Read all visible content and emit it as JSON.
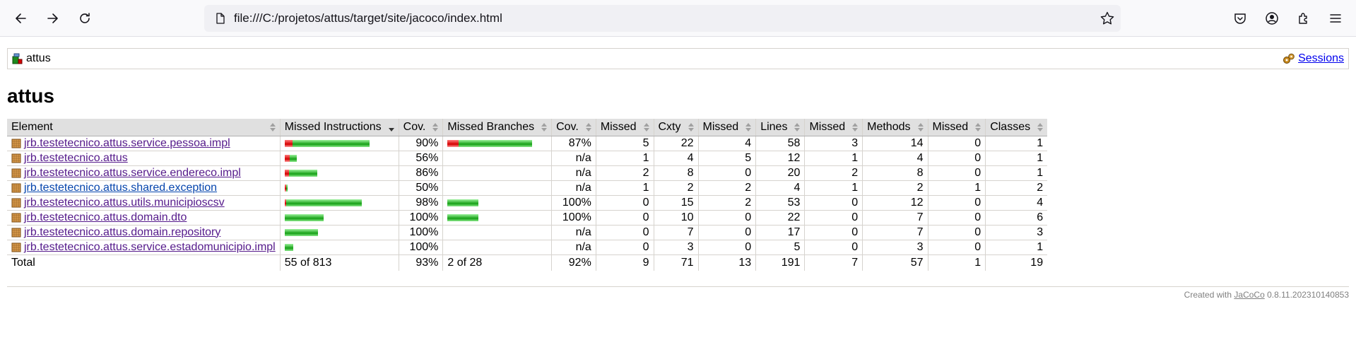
{
  "browser": {
    "url": "file:///C:/projetos/attus/target/site/jacoco/index.html"
  },
  "breadcrumb": {
    "report_name": "attus",
    "sessions_label": "Sessions"
  },
  "page_title": "attus",
  "table": {
    "headers": [
      "Element",
      "Missed Instructions",
      "Cov.",
      "Missed Branches",
      "Cov.",
      "Missed",
      "Cxty",
      "Missed",
      "Lines",
      "Missed",
      "Methods",
      "Missed",
      "Classes"
    ],
    "rows": [
      {
        "name": "jrb.testetecnico.attus.service.pessoa.impl",
        "instr_missed_frac": 0.09,
        "instr_bar": 1.0,
        "instr_cov": "90%",
        "branch_bar": 1.0,
        "branch_missed_frac": 0.13,
        "branch_cov": "87%",
        "cxty_missed": "5",
        "cxty": "22",
        "lines_missed": "4",
        "lines": "58",
        "methods_missed": "3",
        "methods": "14",
        "classes_missed": "0",
        "classes": "1",
        "visited": true
      },
      {
        "name": "jrb.testetecnico.attus",
        "instr_missed_frac": 0.44,
        "instr_bar": 0.14,
        "instr_cov": "56%",
        "branch_bar": 0,
        "branch_missed_frac": 0,
        "branch_cov": "n/a",
        "cxty_missed": "1",
        "cxty": "4",
        "lines_missed": "5",
        "lines": "12",
        "methods_missed": "1",
        "methods": "4",
        "classes_missed": "0",
        "classes": "1",
        "visited": true
      },
      {
        "name": "jrb.testetecnico.attus.service.endereco.impl",
        "instr_missed_frac": 0.14,
        "instr_bar": 0.38,
        "instr_cov": "86%",
        "branch_bar": 0,
        "branch_missed_frac": 0,
        "branch_cov": "n/a",
        "cxty_missed": "2",
        "cxty": "8",
        "lines_missed": "0",
        "lines": "20",
        "methods_missed": "2",
        "methods": "8",
        "classes_missed": "0",
        "classes": "1",
        "visited": true
      },
      {
        "name": "jrb.testetecnico.attus.shared.exception",
        "instr_missed_frac": 0.5,
        "instr_bar": 0.03,
        "instr_cov": "50%",
        "branch_bar": 0,
        "branch_missed_frac": 0,
        "branch_cov": "n/a",
        "cxty_missed": "1",
        "cxty": "2",
        "lines_missed": "2",
        "lines": "4",
        "methods_missed": "1",
        "methods": "2",
        "classes_missed": "1",
        "classes": "2",
        "visited": false
      },
      {
        "name": "jrb.testetecnico.attus.utils.municipioscsv",
        "instr_missed_frac": 0.02,
        "instr_bar": 0.91,
        "instr_cov": "98%",
        "branch_bar": 0.37,
        "branch_missed_frac": 0,
        "branch_cov": "100%",
        "cxty_missed": "0",
        "cxty": "15",
        "lines_missed": "2",
        "lines": "53",
        "methods_missed": "0",
        "methods": "12",
        "classes_missed": "0",
        "classes": "4",
        "visited": true
      },
      {
        "name": "jrb.testetecnico.attus.domain.dto",
        "instr_missed_frac": 0,
        "instr_bar": 0.46,
        "instr_cov": "100%",
        "branch_bar": 0.37,
        "branch_missed_frac": 0,
        "branch_cov": "100%",
        "cxty_missed": "0",
        "cxty": "10",
        "lines_missed": "0",
        "lines": "22",
        "methods_missed": "0",
        "methods": "7",
        "classes_missed": "0",
        "classes": "6",
        "visited": true
      },
      {
        "name": "jrb.testetecnico.attus.domain.repository",
        "instr_missed_frac": 0,
        "instr_bar": 0.39,
        "instr_cov": "100%",
        "branch_bar": 0,
        "branch_missed_frac": 0,
        "branch_cov": "n/a",
        "cxty_missed": "0",
        "cxty": "7",
        "lines_missed": "0",
        "lines": "17",
        "methods_missed": "0",
        "methods": "7",
        "classes_missed": "0",
        "classes": "3",
        "visited": true
      },
      {
        "name": "jrb.testetecnico.attus.service.estadomunicipio.impl",
        "instr_missed_frac": 0,
        "instr_bar": 0.1,
        "instr_cov": "100%",
        "branch_bar": 0,
        "branch_missed_frac": 0,
        "branch_cov": "n/a",
        "cxty_missed": "0",
        "cxty": "3",
        "lines_missed": "0",
        "lines": "5",
        "methods_missed": "0",
        "methods": "3",
        "classes_missed": "0",
        "classes": "1",
        "visited": true
      }
    ],
    "total": {
      "label": "Total",
      "instr": "55 of 813",
      "instr_cov": "93%",
      "branch": "2 of 28",
      "branch_cov": "92%",
      "cxty_missed": "9",
      "cxty": "71",
      "lines_missed": "13",
      "lines": "191",
      "methods_missed": "7",
      "methods": "57",
      "classes_missed": "1",
      "classes": "19"
    }
  },
  "footer": {
    "prefix": "Created with",
    "link": "JaCoCo",
    "version": "0.8.11.202310140853"
  },
  "colors": {
    "missed": "#d40000",
    "covered": "#16a016",
    "header_bg": "#e0e0e0",
    "visited_link": "#551a8b",
    "link": "#0645ad"
  }
}
